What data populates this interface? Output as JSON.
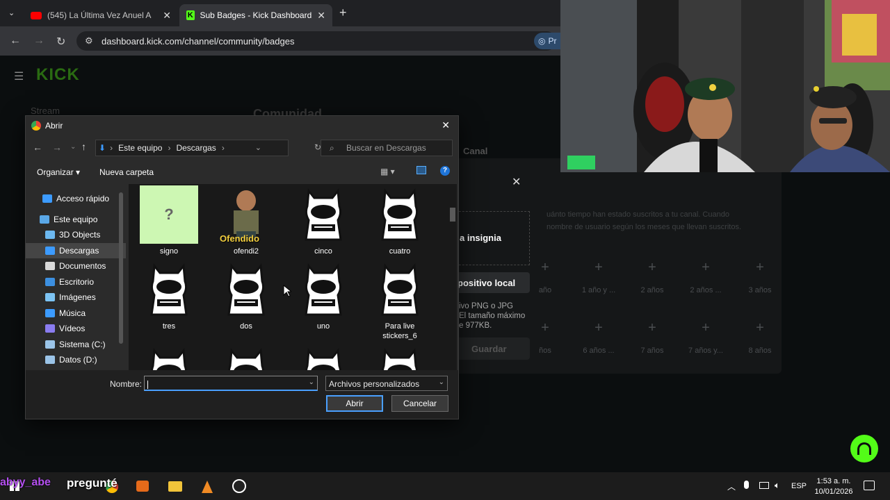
{
  "browser": {
    "tabs": [
      {
        "title": "(545) La Última Vez Anuel Aa Ft",
        "icon": "youtube-icon"
      },
      {
        "title": "Sub Badges - Kick Dashboard",
        "icon": "kick-icon"
      }
    ],
    "url": "dashboard.kick.com/channel/community/badges",
    "ext_label": "Pr"
  },
  "kick": {
    "logo": "KICK",
    "sidebar_stream": "Stream",
    "heading": "Comunidad",
    "canal": "Canal",
    "desc1": "uánto tiempo han estado suscritos a tu canal. Cuando",
    "desc2": "nombre de usuario según los meses que llevan suscritos.",
    "upload_label": "a insignia",
    "local_label": "positivo local",
    "format1": "ivo PNG o JPG",
    "format2": "El tamaño máximo",
    "format3": "e 977KB.",
    "save_label": "Guardar",
    "row1": [
      "año",
      "1 año y ...",
      "2 años",
      "2 años ...",
      "3 años"
    ],
    "row2": [
      "ños",
      "6 años ...",
      "7 años",
      "7 años y...",
      "8 años"
    ]
  },
  "dialog": {
    "title": "Abrir",
    "breadcrumb": [
      "Este equipo",
      "Descargas"
    ],
    "search_placeholder": "Buscar en Descargas",
    "organize": "Organizar ▾",
    "new_folder": "Nueva carpeta",
    "nav": [
      {
        "label": "Acceso rápido",
        "icon": "star-icon",
        "color": "#3c9bff"
      },
      {
        "label": "Este equipo",
        "icon": "computer-icon",
        "color": "#5aa7e6"
      },
      {
        "label": "3D Objects",
        "icon": "3d-objects-icon",
        "color": "#6cb8f0"
      },
      {
        "label": "Descargas",
        "icon": "download-icon",
        "color": "#3c9bff"
      },
      {
        "label": "Documentos",
        "icon": "document-icon",
        "color": "#d9d9d9"
      },
      {
        "label": "Escritorio",
        "icon": "desktop-icon",
        "color": "#3c8fe0"
      },
      {
        "label": "Imágenes",
        "icon": "pictures-icon",
        "color": "#7cc3f3"
      },
      {
        "label": "Música",
        "icon": "music-icon",
        "color": "#3c9bff"
      },
      {
        "label": "Vídeos",
        "icon": "videos-icon",
        "color": "#8a7cf0"
      },
      {
        "label": "Sistema (C:)",
        "icon": "drive-icon",
        "color": "#9bc4e8"
      },
      {
        "label": "Datos (D:)",
        "icon": "drive-icon",
        "color": "#9bc4e8"
      }
    ],
    "files": [
      {
        "name": "signo",
        "thumb": "question"
      },
      {
        "name": "ofendi2",
        "thumb": "ofendido",
        "caption": "Ofendido"
      },
      {
        "name": "cinco",
        "thumb": "sticker"
      },
      {
        "name": "cuatro",
        "thumb": "sticker"
      },
      {
        "name": "tres",
        "thumb": "sticker"
      },
      {
        "name": "dos",
        "thumb": "sticker"
      },
      {
        "name": "uno",
        "thumb": "sticker"
      },
      {
        "name": "Para live\nstickers_6",
        "thumb": "sticker"
      }
    ],
    "filename_label": "Nombre:",
    "filename_value": "",
    "filetype": "Archivos personalizados",
    "open_label": "Abrir",
    "cancel_label": "Cancelar"
  },
  "overlay": {
    "name": "abyy_abe",
    "text": "pregunté"
  },
  "taskbar": {
    "lang": "ESP",
    "time": "1:53 a. m.",
    "date": "10/01/2026"
  }
}
